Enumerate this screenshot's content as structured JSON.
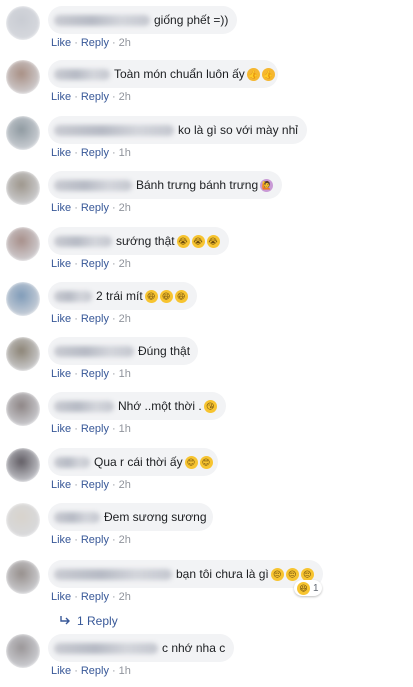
{
  "comments": [
    {
      "text": "giống phết =))",
      "like": "Like",
      "reply": "Reply",
      "time": "2h",
      "emojis": [],
      "avatar_color": "#c9ccd3"
    },
    {
      "text": "Toàn món chuẩn luôn ấy",
      "like": "Like",
      "reply": "Reply",
      "time": "2h",
      "emojis": [
        "thumbs-up",
        "thumbs-up"
      ],
      "avatar_color": "#a88f84"
    },
    {
      "text": "ko là gì so với mày nhỉ",
      "like": "Like",
      "reply": "Reply",
      "time": "1h",
      "emojis": [],
      "avatar_color": "#8f9aa1"
    },
    {
      "text": "Bánh trưng bánh trưng",
      "like": "Like",
      "reply": "Reply",
      "time": "2h",
      "emojis": [
        "person-gesturing"
      ],
      "avatar_color": "#9d968c"
    },
    {
      "text": "sướng thật",
      "like": "Like",
      "reply": "Reply",
      "time": "2h",
      "emojis": [
        "crying-face",
        "crying-face",
        "crying-face"
      ],
      "avatar_color": "#a78f8a"
    },
    {
      "text": "2 trái mít",
      "like": "Like",
      "reply": "Reply",
      "time": "2h",
      "emojis": [
        "grinning-face",
        "grinning-face",
        "grinning-face"
      ],
      "avatar_color": "#7f9bb8"
    },
    {
      "text": "Đúng thật",
      "like": "Like",
      "reply": "Reply",
      "time": "1h",
      "emojis": [],
      "avatar_color": "#8c8476"
    },
    {
      "text": "Nhớ ..một thời .",
      "like": "Like",
      "reply": "Reply",
      "time": "1h",
      "emojis": [
        "kissing-face"
      ],
      "avatar_color": "#8d8585"
    },
    {
      "text": "Qua r cái thời ấy",
      "like": "Like",
      "reply": "Reply",
      "time": "2h",
      "emojis": [
        "smiling-face",
        "smiling-face"
      ],
      "avatar_color": "#615d64"
    },
    {
      "text": "Đem sương sương",
      "like": "Like",
      "reply": "Reply",
      "time": "2h",
      "emojis": [],
      "avatar_color": "#d8d3cc"
    },
    {
      "text": "bạn tôi chưa là gì",
      "like": "Like",
      "reply": "Reply",
      "time": "2h",
      "emojis": [
        "relieved-face",
        "relieved-face",
        "relieved-face"
      ],
      "avatar_color": "#968f8c",
      "reaction_count": "1"
    },
    {
      "text": "c nhớ nha c",
      "like": "Like",
      "reply": "Reply",
      "time": "1h",
      "emojis": [],
      "avatar_color": "#9a9698"
    }
  ],
  "replies_link": "1 Reply",
  "colors": {
    "link": "#385898",
    "bubble": "#f2f3f5",
    "meta": "#90949c"
  }
}
